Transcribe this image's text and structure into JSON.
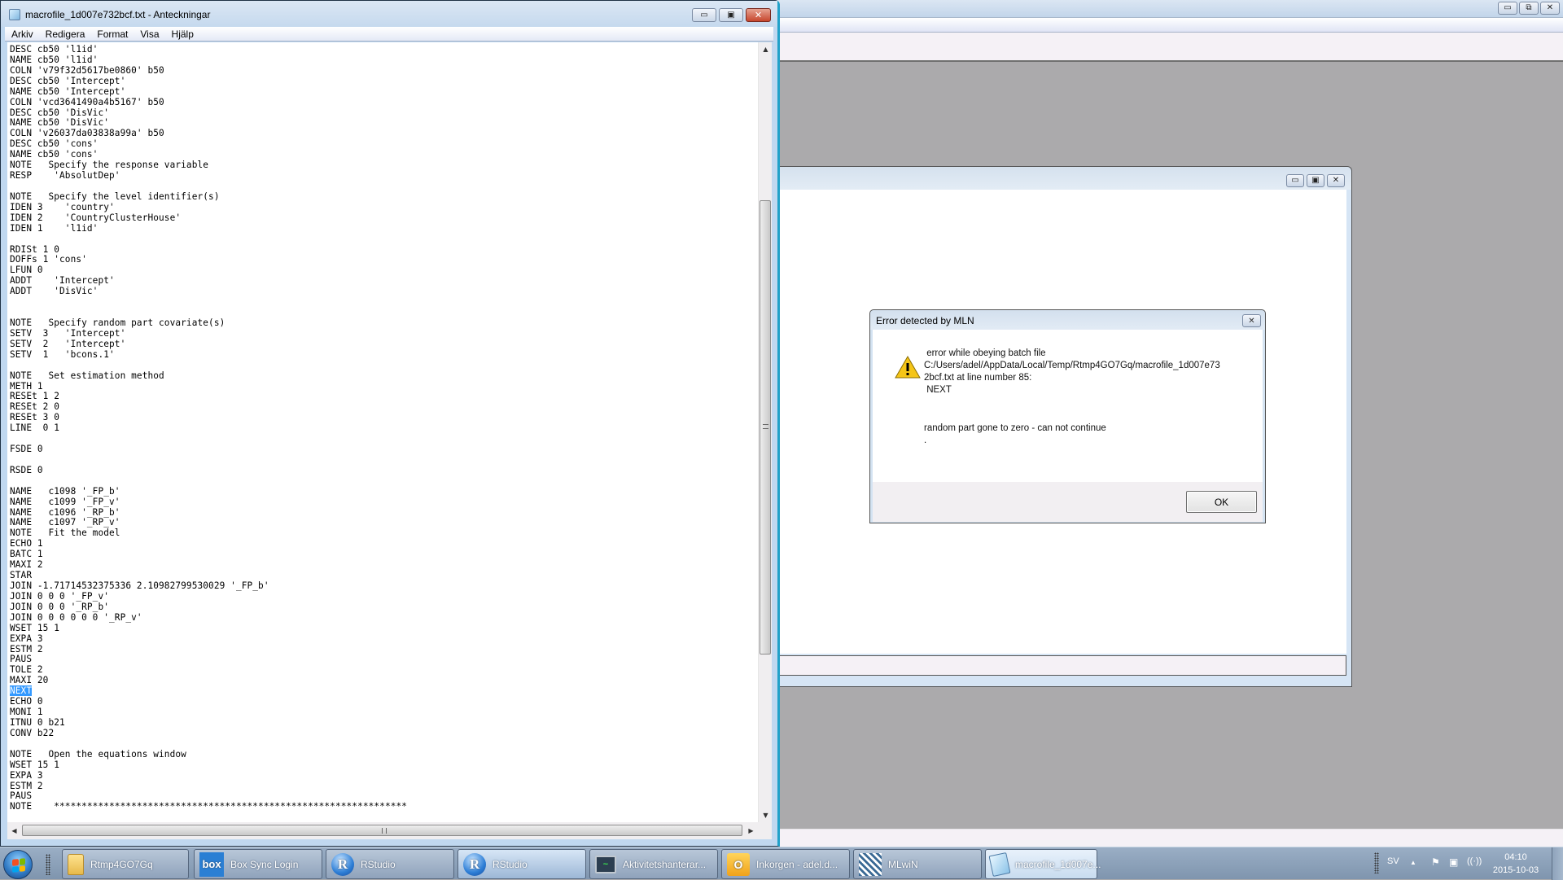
{
  "notepad": {
    "title": "macrofile_1d007e732bcf.txt - Anteckningar",
    "menu": [
      "Arkiv",
      "Redigera",
      "Format",
      "Visa",
      "Hjälp"
    ],
    "lines_before_selection": "DESC cb50 'l1id'\nNAME cb50 'l1id'\nCOLN 'v79f32d5617be0860' b50\nDESC cb50 'Intercept'\nNAME cb50 'Intercept'\nCOLN 'vcd3641490a4b5167' b50\nDESC cb50 'DisVic'\nNAME cb50 'DisVic'\nCOLN 'v26037da03838a99a' b50\nDESC cb50 'cons'\nNAME cb50 'cons'\nNOTE   Specify the response variable\nRESP    'AbsolutDep'\n\nNOTE   Specify the level identifier(s)\nIDEN 3    'country'\nIDEN 2    'CountryClusterHouse'\nIDEN 1    'l1id'\n\nRDISt 1 0\nDOFFs 1 'cons'\nLFUN 0\nADDT    'Intercept'\nADDT    'DisVic'\n\n\nNOTE   Specify random part covariate(s)\nSETV  3   'Intercept'\nSETV  2   'Intercept'\nSETV  1   'bcons.1'\n\nNOTE   Set estimation method\nMETH 1\nRESEt 1 2\nRESEt 2 0\nRESEt 3 0\nLINE  0 1\n\nFSDE 0\n\nRSDE 0\n\nNAME   c1098 '_FP_b'\nNAME   c1099 '_FP_v'\nNAME   c1096 '_RP_b'\nNAME   c1097 '_RP_v'\nNOTE   Fit the model\nECHO 1\nBATC 1\nMAXI 2\nSTAR\nJOIN -1.71714532375336 2.10982799530029 '_FP_b'\nJOIN 0 0 0 '_FP_v'\nJOIN 0 0 0 '_RP_b'\nJOIN 0 0 0 0 0 0 '_RP_v'\nWSET 15 1\nEXPA 3\nESTM 2\nPAUS\nTOLE 2\nMAXI 20\n",
    "selected_text": "NEXT",
    "lines_after_selection": "\nECHO 0\nMONI 1\nITNU 0 b21\nCONV b22\n\nNOTE   Open the equations window\nWSET 15 1\nEXPA 3\nESTM 2\nPAUS\nNOTE    ****************************************************************"
  },
  "dialog": {
    "title": "Error detected by MLN",
    "message": " error while obeying batch file\nC:/Users/adel/AppData/Local/Temp/Rtmp4GO7Gq/macrofile_1d007e73\n2bcf.txt at line number 85:\n NEXT",
    "detail": "random part gone to zero - can not continue\n.",
    "ok_label": "OK",
    "icon": "warning-icon"
  },
  "taskbar": {
    "items": [
      {
        "label": "Rtmp4GO7Gq",
        "icon": "folder-icon"
      },
      {
        "label": "Box Sync Login",
        "icon": "box-icon",
        "icon_text": "box"
      },
      {
        "label": "RStudio",
        "icon": "r-icon",
        "icon_text": "R"
      },
      {
        "label": "RStudio",
        "icon": "r-icon",
        "icon_text": "R"
      },
      {
        "label": "Aktivitetshanterar...",
        "icon": "task-manager-icon"
      },
      {
        "label": "Inkorgen - adel.d...",
        "icon": "outlook-icon",
        "icon_text": "O"
      },
      {
        "label": "MLwiN",
        "icon": "mlwin-icon"
      },
      {
        "label": "macrofile_1d007e...",
        "icon": "notepad-icon"
      }
    ],
    "tray": {
      "language": "SV",
      "time": "04:10",
      "date": "2015-10-03"
    }
  },
  "glyphs": {
    "minimize": "▭",
    "maximize": "▣",
    "restore": "⧉",
    "close": "✕",
    "up": "▲",
    "down": "▼",
    "left": "◀",
    "right": "▶",
    "tray_up": "▲",
    "flag": "⚑",
    "network": "▣",
    "volume": "🔊"
  }
}
